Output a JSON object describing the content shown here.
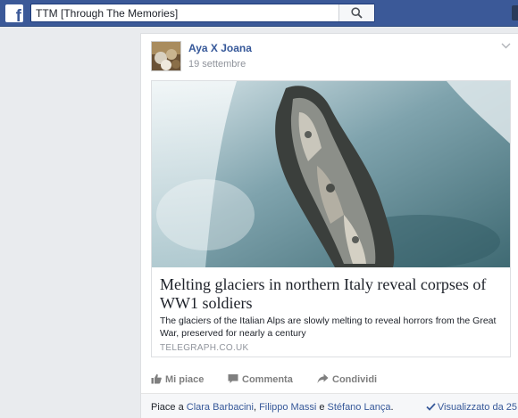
{
  "search": {
    "value": "TTM [Through The Memories]"
  },
  "post": {
    "author": "Aya X Joana",
    "date": "19 settembre",
    "link": {
      "headline": "Melting glaciers in northern Italy reveal corpses of WW1 soldiers",
      "description": "The glaciers of the Italian Alps are slowly melting to reveal horrors from the Great War, preserved for nearly a century",
      "domain": "TELEGRAPH.CO.UK"
    },
    "actions": {
      "like": "Mi piace",
      "comment": "Commenta",
      "share": "Condividi"
    },
    "likes": {
      "prefix": "Piace a ",
      "names": [
        "Clara Barbacini",
        "Filippo Massi",
        "Stéfano Lança"
      ],
      "sep1": ", ",
      "sep2": " e ",
      "suffix": "."
    },
    "seen": "Visualizzato da 25"
  },
  "colors": {
    "brand": "#3b5998",
    "link": "#365899",
    "muted": "#90949c"
  }
}
